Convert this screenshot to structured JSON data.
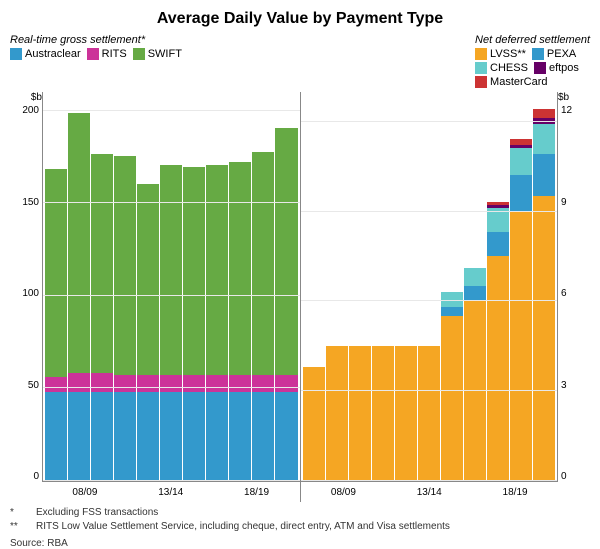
{
  "title": "Average Daily Value by Payment Type",
  "y_label_left": "$b",
  "y_label_right": "$b",
  "left_chart": {
    "section_title": "Real-time gross settlement*",
    "legend": [
      {
        "label": "Austraclear",
        "color": "#3399CC"
      },
      {
        "label": "RITS",
        "color": "#CC3399"
      },
      {
        "label": "SWIFT",
        "color": "#66AA44"
      }
    ],
    "y_ticks": [
      "200",
      "150",
      "100",
      "50",
      "0"
    ],
    "x_labels": [
      "08/09",
      "13/14",
      "18/19"
    ],
    "bars": [
      {
        "austraclear": 48,
        "rits": 8,
        "swift": 112
      },
      {
        "austraclear": 48,
        "rits": 10,
        "swift": 140
      },
      {
        "austraclear": 48,
        "rits": 10,
        "swift": 118
      },
      {
        "austraclear": 48,
        "rits": 9,
        "swift": 118
      },
      {
        "austraclear": 48,
        "rits": 9,
        "swift": 103
      },
      {
        "austraclear": 48,
        "rits": 9,
        "swift": 113
      },
      {
        "austraclear": 48,
        "rits": 9,
        "swift": 112
      },
      {
        "austraclear": 48,
        "rits": 9,
        "swift": 113
      },
      {
        "austraclear": 48,
        "rits": 9,
        "swift": 115
      },
      {
        "austraclear": 48,
        "rits": 9,
        "swift": 120
      },
      {
        "austraclear": 48,
        "rits": 9,
        "swift": 133
      }
    ]
  },
  "right_chart": {
    "section_title": "Net deferred settlement",
    "legend": [
      {
        "label": "LVSS**",
        "color": "#F5A623"
      },
      {
        "label": "PEXA",
        "color": "#3399CC"
      },
      {
        "label": "CHESS",
        "color": "#66CCCC"
      },
      {
        "label": "eftpos",
        "color": "#660066"
      },
      {
        "label": "MasterCard",
        "color": "#CC3333"
      }
    ],
    "y_ticks": [
      "12",
      "9",
      "6",
      "3",
      "0"
    ],
    "x_labels": [
      "08/09",
      "13/14",
      "18/19"
    ],
    "bars": [
      {
        "lvss": 3.8,
        "pexa": 0,
        "chess": 0,
        "eftpos": 0,
        "mastercard": 0
      },
      {
        "lvss": 4.5,
        "pexa": 0,
        "chess": 0,
        "eftpos": 0,
        "mastercard": 0
      },
      {
        "lvss": 4.5,
        "pexa": 0,
        "chess": 0,
        "eftpos": 0,
        "mastercard": 0
      },
      {
        "lvss": 4.5,
        "pexa": 0,
        "chess": 0,
        "eftpos": 0,
        "mastercard": 0
      },
      {
        "lvss": 4.5,
        "pexa": 0,
        "chess": 0,
        "eftpos": 0,
        "mastercard": 0
      },
      {
        "lvss": 4.5,
        "pexa": 0,
        "chess": 0,
        "eftpos": 0,
        "mastercard": 0
      },
      {
        "lvss": 5.5,
        "pexa": 0.3,
        "chess": 0.5,
        "eftpos": 0,
        "mastercard": 0
      },
      {
        "lvss": 6.0,
        "pexa": 0.5,
        "chess": 0.6,
        "eftpos": 0,
        "mastercard": 0
      },
      {
        "lvss": 7.5,
        "pexa": 0.8,
        "chess": 0.8,
        "eftpos": 0.1,
        "mastercard": 0.1
      },
      {
        "lvss": 9.0,
        "pexa": 1.2,
        "chess": 0.9,
        "eftpos": 0.1,
        "mastercard": 0.2
      },
      {
        "lvss": 9.5,
        "pexa": 1.4,
        "chess": 1.0,
        "eftpos": 0.2,
        "mastercard": 0.3
      }
    ]
  },
  "footnotes": [
    {
      "star": "*",
      "text": "Excluding FSS transactions"
    },
    {
      "star": "**",
      "text": "RITS Low Value Settlement Service, including cheque, direct entry, ATM and Visa settlements"
    }
  ],
  "source": "Source:   RBA"
}
